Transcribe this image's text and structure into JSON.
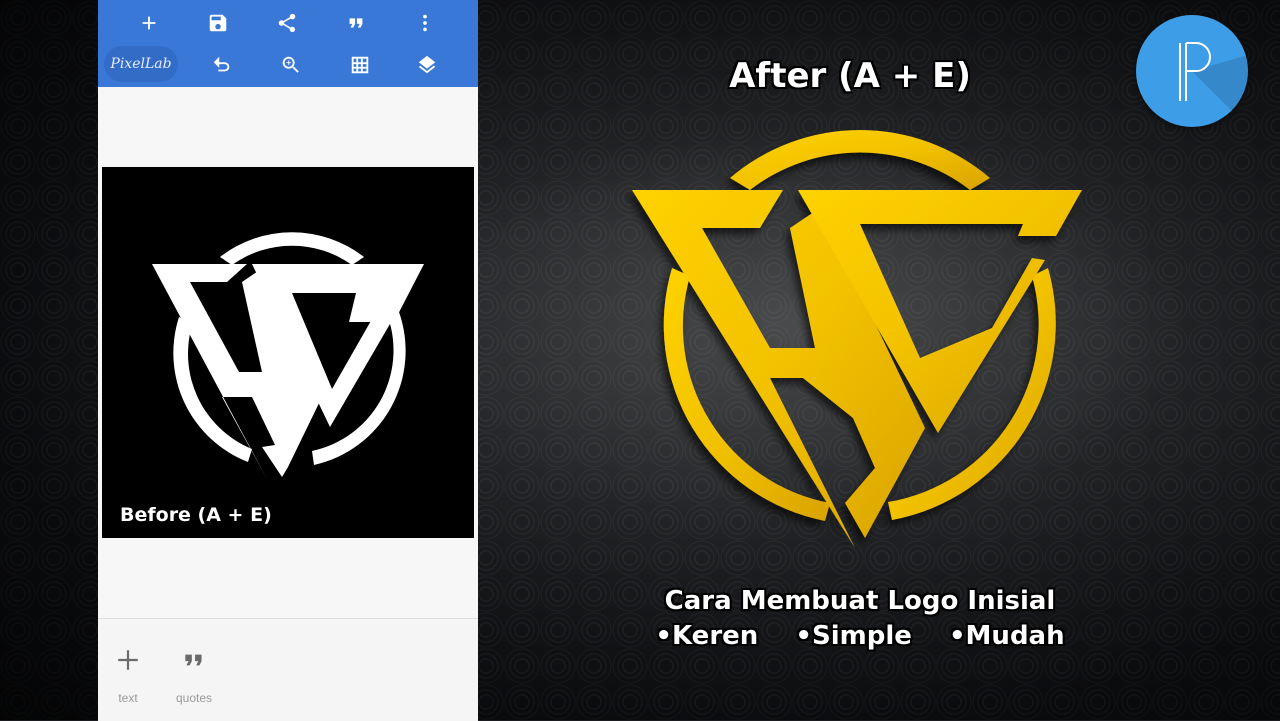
{
  "app": {
    "name": "PixelLab",
    "toolbar": {
      "row1": [
        {
          "icon": "plus-icon",
          "label": "Add"
        },
        {
          "icon": "save-icon",
          "label": "Save"
        },
        {
          "icon": "share-icon",
          "label": "Share"
        },
        {
          "icon": "quote-icon",
          "label": "Quotes"
        },
        {
          "icon": "more-vert-icon",
          "label": "More"
        }
      ],
      "row2": [
        {
          "icon": "undo-icon",
          "label": "Undo"
        },
        {
          "icon": "zoom-in-icon",
          "label": "Zoom"
        },
        {
          "icon": "grid-icon",
          "label": "Grid"
        },
        {
          "icon": "layers-icon",
          "label": "Layers"
        }
      ],
      "brand_label": "PixelLab"
    },
    "artboard": {
      "caption": "Before (A + E)",
      "background": "#000000",
      "logo_color": "#ffffff"
    },
    "bottom_bar": [
      {
        "icon": "plus-icon",
        "label": "text"
      },
      {
        "icon": "quote-icon",
        "label": "quotes"
      }
    ],
    "accent_color": "#3a78d8"
  },
  "thumbnail": {
    "headline": "After (A + E)",
    "logo_color": "#f2c200",
    "caption_line1": "Cara Membuat Logo Inisial",
    "tags": [
      "•Keren",
      "•Simple",
      "•Mudah"
    ],
    "badge_letter": "P",
    "badge_color": "#3d9de6"
  }
}
